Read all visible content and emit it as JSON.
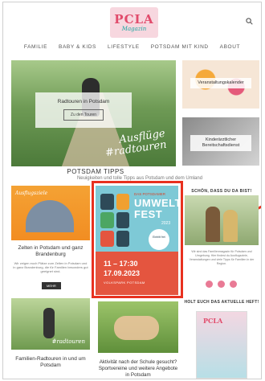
{
  "brand": {
    "logo_main": "PCLA",
    "logo_sub": "Magazin"
  },
  "nav": [
    "FAMILIE",
    "BABY & KIDS",
    "LIFESTYLE",
    "POTSDAM MIT KIND",
    "ABOUT"
  ],
  "hero": {
    "title": "Radtouren in Potsdam",
    "button": "Zu den Touren",
    "script_1": "Ausflüge",
    "script_2": "#radtouren"
  },
  "side_cards": [
    "Veranstaltungskalender",
    "Kinderärztlicher Bereitschaftsdienst"
  ],
  "section": {
    "title": "POTSDAM TIPPS",
    "subtitle": "Neuigkeiten und tolle Tipps aus Potsdam und dem Umland"
  },
  "posts": [
    {
      "title": "Zelten in Potsdam und ganz Brandenburg",
      "excerpt": "Wir zeigen euch Plätze zum Zelten in Potsdam und in ganz Brandenburg, die für Familien besonders gut geeignet sind.",
      "button": "MEHR",
      "badge": "Ausflugsziele"
    },
    {
      "title": "Familien-Radtouren in und um Potsdam",
      "script": "#radtouren"
    },
    {
      "title": "Aktivität nach der Schule gesucht? Sportvereine und weitere Angebote in Potsdam"
    }
  ],
  "poster": {
    "kicker": "DAS POTSDAMER",
    "word1": "UMWELT",
    "word2": "FEST",
    "year": "2023",
    "circle": "Eintritt frei",
    "time": "11 – 17:30",
    "date": "17.09.2023",
    "place": "VOLKSPARK POTSDAM"
  },
  "sidebar": {
    "welcome_title": "SCHÖN, DASS DU DA BIST!",
    "welcome_text": "Wir sind das Familienmagazin für Potsdam und Umgebung. Hier findest du Ausflugsziele, Veranstaltungen und viele Tipps für Familien in der Region.",
    "issue_title": "HOLT EUCH DAS AKTUELLE HEFT!",
    "issue_logo": "PCLA"
  },
  "colors": {
    "accent": "#e14b6b",
    "highlight": "#e8311f",
    "teal": "#1aa6a1"
  }
}
